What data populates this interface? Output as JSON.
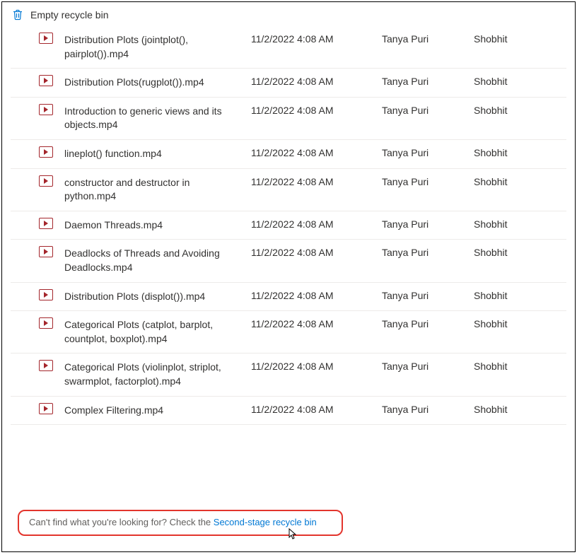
{
  "header": {
    "empty_label": "Empty recycle bin"
  },
  "files": [
    {
      "name": "Distribution Plots (jointplot(), pairplot()).mp4",
      "date": "11/2/2022 4:08 AM",
      "deletedBy": "Tanya Puri",
      "createdBy": "Shobhit"
    },
    {
      "name": "Distribution Plots(rugplot()).mp4",
      "date": "11/2/2022 4:08 AM",
      "deletedBy": "Tanya Puri",
      "createdBy": "Shobhit"
    },
    {
      "name": "Introduction to generic views and its objects.mp4",
      "date": "11/2/2022 4:08 AM",
      "deletedBy": "Tanya Puri",
      "createdBy": "Shobhit"
    },
    {
      "name": "lineplot() function.mp4",
      "date": "11/2/2022 4:08 AM",
      "deletedBy": "Tanya Puri",
      "createdBy": "Shobhit"
    },
    {
      "name": "constructor and destructor in python.mp4",
      "date": "11/2/2022 4:08 AM",
      "deletedBy": "Tanya Puri",
      "createdBy": "Shobhit"
    },
    {
      "name": "Daemon Threads.mp4",
      "date": "11/2/2022 4:08 AM",
      "deletedBy": "Tanya Puri",
      "createdBy": "Shobhit"
    },
    {
      "name": "Deadlocks of Threads and Avoiding Deadlocks.mp4",
      "date": "11/2/2022 4:08 AM",
      "deletedBy": "Tanya Puri",
      "createdBy": "Shobhit"
    },
    {
      "name": "Distribution Plots (displot()).mp4",
      "date": "11/2/2022 4:08 AM",
      "deletedBy": "Tanya Puri",
      "createdBy": "Shobhit"
    },
    {
      "name": "Categorical Plots (catplot, barplot, countplot, boxplot).mp4",
      "date": "11/2/2022 4:08 AM",
      "deletedBy": "Tanya Puri",
      "createdBy": "Shobhit"
    },
    {
      "name": "Categorical Plots (violinplot, striplot, swarmplot, factorplot).mp4",
      "date": "11/2/2022 4:08 AM",
      "deletedBy": "Tanya Puri",
      "createdBy": "Shobhit"
    },
    {
      "name": "Complex Filtering.mp4",
      "date": "11/2/2022 4:08 AM",
      "deletedBy": "Tanya Puri",
      "createdBy": "Shobhit"
    }
  ],
  "footer": {
    "prefix": "Can't find what you're looking for? Check the ",
    "link": "Second-stage recycle bin"
  }
}
